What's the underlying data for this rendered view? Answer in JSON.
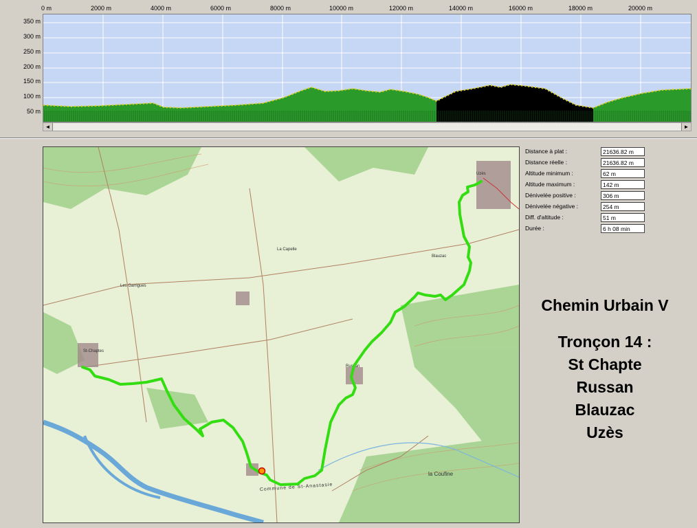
{
  "profile": {
    "x_ticks": [
      "0 m",
      "2000 m",
      "4000 m",
      "6000 m",
      "8000 m",
      "10000 m",
      "12000 m",
      "14000 m",
      "16000 m",
      "18000 m",
      "20000 m"
    ],
    "y_ticks": [
      "350 m",
      "300 m",
      "250 m",
      "200 m",
      "150 m",
      "100 m",
      "50 m"
    ],
    "colors": {
      "sky": "#c6d6f5",
      "terrain": "#2a9a2a",
      "dark_terrain": "#000000",
      "points": "#e6d400"
    }
  },
  "scrollbar": {
    "left_arrow": "◄",
    "right_arrow": "►"
  },
  "map": {
    "place_labels": [
      "la Coufine",
      "Commune de St-Anastasie"
    ],
    "route_color": "#33dd11"
  },
  "stats": [
    {
      "label": "Distance à plat :",
      "value": "21636.82 m"
    },
    {
      "label": "Distance réelle :",
      "value": "21636.82 m"
    },
    {
      "label": "Altitude minimum :",
      "value": "62 m"
    },
    {
      "label": "Altitude maximum :",
      "value": "142 m"
    },
    {
      "label": "Dénivelée positive :",
      "value": "306 m"
    },
    {
      "label": "Dénivelée négative :",
      "value": "254 m"
    },
    {
      "label": "Diff. d'altitude :",
      "value": "51 m"
    },
    {
      "label": "Durée :",
      "value": "6 h 08 min"
    }
  ],
  "title": {
    "line1": "Chemin Urbain V",
    "line2": "Tronçon 14 :",
    "line3": "St Chapte",
    "line4": "Russan",
    "line5": "Blauzac",
    "line6": "Uzès"
  }
}
